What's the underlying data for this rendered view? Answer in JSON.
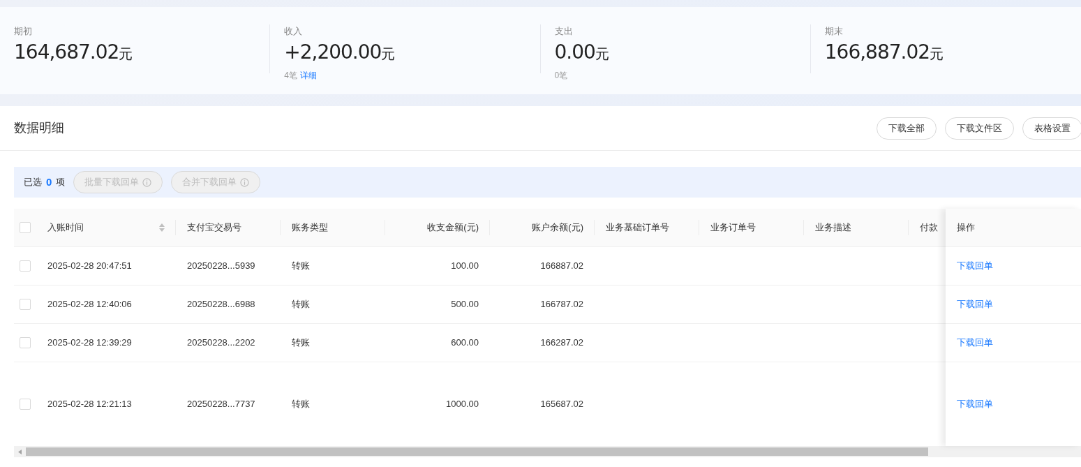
{
  "stats": [
    {
      "label": "期初",
      "amount": "164,687.02",
      "unit": "元"
    },
    {
      "label": "收入",
      "amount": "+2,200.00",
      "unit": "元",
      "count": "4笔",
      "link": "详细"
    },
    {
      "label": "支出",
      "amount": "0.00",
      "unit": "元",
      "count": "0笔"
    },
    {
      "label": "期末",
      "amount": "166,887.02",
      "unit": "元"
    }
  ],
  "section": {
    "title": "数据明细",
    "buttons": [
      "下载全部",
      "下载文件区",
      "表格设置"
    ]
  },
  "selection": {
    "prefix": "已选",
    "count": "0",
    "suffix": "项",
    "buttons": [
      {
        "label": "批量下载回单",
        "disabled": true
      },
      {
        "label": "合并下载回单",
        "disabled": true
      }
    ]
  },
  "table": {
    "header_checked": false,
    "columns": [
      {
        "label": "入账时间",
        "sortable": true
      },
      {
        "label": "支付宝交易号",
        "sortable": false
      },
      {
        "label": "账务类型",
        "sortable": false
      },
      {
        "label": "收支金额(元)",
        "sortable": false
      },
      {
        "label": "账户余额(元)",
        "sortable": false
      },
      {
        "label": "业务基础订单号",
        "sortable": false
      },
      {
        "label": "业务订单号",
        "sortable": false
      },
      {
        "label": "业务描述",
        "sortable": false
      },
      {
        "label": "付款",
        "sortable": false
      }
    ],
    "action_column": "操作",
    "rows": [
      {
        "checked": false,
        "cells": [
          "2025-02-28 20:47:51",
          "20250228...5939",
          "转账",
          "100.00",
          "166887.02"
        ],
        "action": "下载回单"
      },
      {
        "checked": false,
        "cells": [
          "2025-02-28 12:40:06",
          "20250228...6988",
          "转账",
          "500.00",
          "166787.02"
        ],
        "action": "下载回单"
      },
      {
        "checked": false,
        "cells": [
          "2025-02-28 12:39:29",
          "20250228...2202",
          "转账",
          "600.00",
          "166287.02"
        ],
        "action": "下载回单"
      },
      {
        "checked": false,
        "cells": [
          "2025-02-28 12:21:13",
          "20250228...7737",
          "转账",
          "1000.00",
          "165687.02"
        ],
        "action": "下载回单"
      }
    ]
  }
}
